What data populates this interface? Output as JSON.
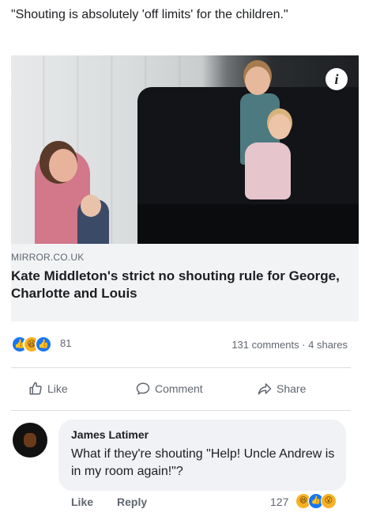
{
  "post": {
    "caption": "\"Shouting is absolutely 'off limits' for the children.\"",
    "link": {
      "source": "MIRROR.CO.UK",
      "headline": "Kate Middleton's strict no shouting rule for George, Charlotte and Louis",
      "info_icon": "info-icon",
      "info_glyph": "i"
    },
    "reactions": {
      "icons": [
        "like-icon",
        "haha-icon",
        "wow-icon"
      ],
      "count": "81"
    },
    "comments_shares": "131 comments · 4 shares",
    "actions": {
      "like_label": "Like",
      "comment_label": "Comment",
      "share_label": "Share"
    }
  },
  "comment": {
    "author": "James Latimer",
    "text": "What if they're shouting \"Help! Uncle Andrew is in my room again!\"?",
    "like_label": "Like",
    "reply_label": "Reply",
    "reaction_count": "127",
    "reaction_icons": [
      "haha-icon",
      "like-icon",
      "wow-icon"
    ]
  },
  "colors": {
    "link_box_bg": "#f2f3f5",
    "meta_text": "#606770",
    "like_blue": "#1877f2",
    "haha_yellow": "#f7b125"
  }
}
